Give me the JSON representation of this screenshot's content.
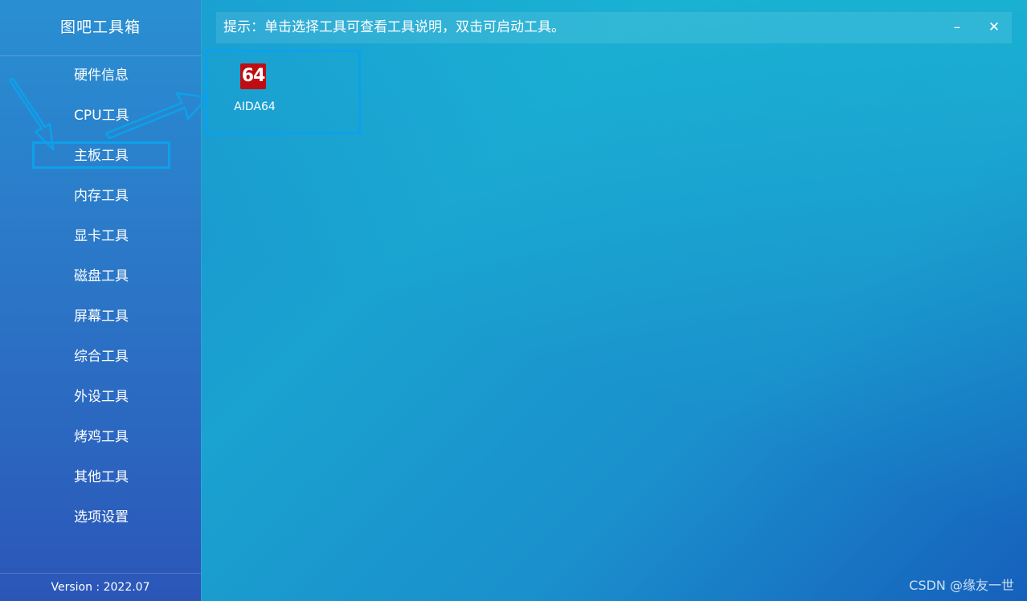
{
  "sidebar": {
    "title": "图吧工具箱",
    "items": [
      {
        "label": "硬件信息"
      },
      {
        "label": "CPU工具"
      },
      {
        "label": "主板工具",
        "active": true
      },
      {
        "label": "内存工具"
      },
      {
        "label": "显卡工具"
      },
      {
        "label": "磁盘工具"
      },
      {
        "label": "屏幕工具"
      },
      {
        "label": "综合工具"
      },
      {
        "label": "外设工具"
      },
      {
        "label": "烤鸡工具"
      },
      {
        "label": "其他工具"
      },
      {
        "label": "选项设置"
      }
    ],
    "version": "Version : 2022.07"
  },
  "hint": {
    "text": "提示：单击选择工具可查看工具说明，双击可启动工具。",
    "minimize_label": "–",
    "close_label": "✕"
  },
  "tools": [
    {
      "label": "AIDA64",
      "icon_text": "64",
      "icon_name": "aida64-icon",
      "icon_color": "#c00d12"
    }
  ],
  "watermark": "CSDN @缘友一世",
  "colors": {
    "accent_box": "#0ea0ea"
  }
}
